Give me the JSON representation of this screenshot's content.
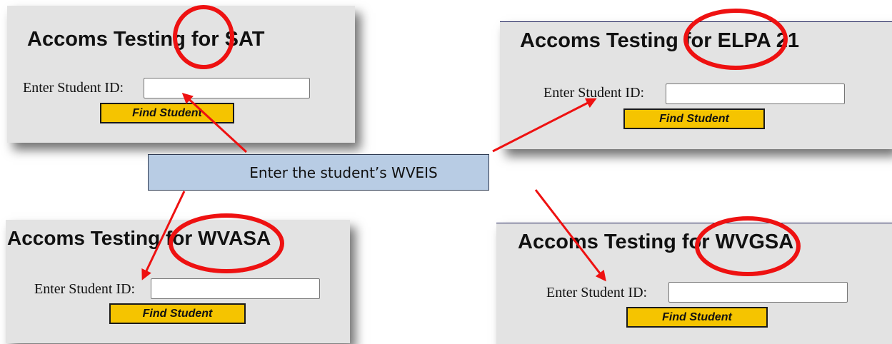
{
  "panels": {
    "sat": {
      "title": "Accoms Testing for SAT",
      "label": "Enter Student ID:",
      "button": "Find Student"
    },
    "elpa": {
      "title": "Accoms Testing for ELPA 21",
      "label": "Enter Student ID:",
      "button": "Find Student"
    },
    "wvasa": {
      "title": "Accoms Testing for WVASA",
      "label": "Enter Student ID:",
      "button": "Find Student"
    },
    "wvgsa": {
      "title": "Accoms Testing for WVGSA",
      "label": "Enter Student ID:",
      "button": "Find Student"
    }
  },
  "callout": {
    "text": "Enter the student’s WVEIS"
  },
  "colors": {
    "panel_bg": "#e3e3e3",
    "button": "#f5c400",
    "callout": "#b8cce4",
    "annotation": "#ee1111"
  }
}
